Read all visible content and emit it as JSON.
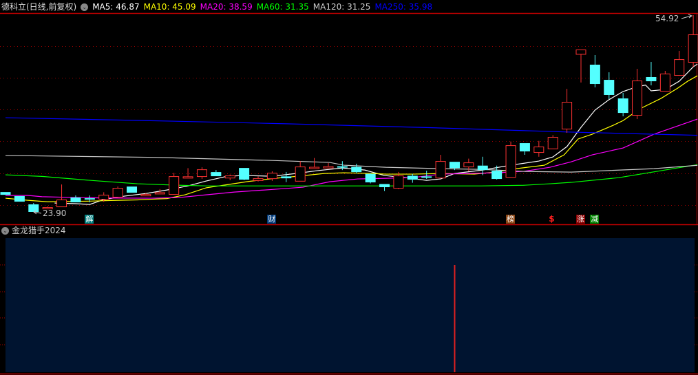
{
  "header": {
    "title": "德科立(日线,前复权)",
    "ma": [
      {
        "label": "MA5: 46.87",
        "color": "#ffffff"
      },
      {
        "label": "MA10: 45.09",
        "color": "#ffff00"
      },
      {
        "label": "MA20: 38.59",
        "color": "#ff00ff"
      },
      {
        "label": "MA60: 31.35",
        "color": "#00ff00"
      },
      {
        "label": "MA120: 31.25",
        "color": "#c8c8c8"
      },
      {
        "label": "MA250: 35.98",
        "color": "#0000ff"
      }
    ]
  },
  "indicator": {
    "title": "金龙猎手2024",
    "signal_candle_index": 32
  },
  "markers": [
    {
      "label": "解",
      "candle": 6,
      "bg": "#008080",
      "color": "#ffffff"
    },
    {
      "label": "财",
      "candle": 19,
      "bg": "#003a7a",
      "color": "#ffffff"
    },
    {
      "label": "榜",
      "candle": 36,
      "bg": "#8b4513",
      "color": "#ffffff"
    },
    {
      "label": "$",
      "candle": 39,
      "bg": "transparent",
      "color": "#ff2020"
    },
    {
      "label": "涨",
      "candle": 41,
      "bg": "#8b0000",
      "color": "#ffffff"
    },
    {
      "label": "减",
      "candle": 42,
      "bg": "#008000",
      "color": "#ffffff"
    }
  ],
  "chart_data": {
    "type": "candlestick",
    "high_label": "54.92",
    "low_label": "23.90",
    "price_max": 54.92,
    "price_min": 23.9,
    "up_color": "#ff3232",
    "down_color": "#54ffff",
    "candles": [
      [
        27.03,
        27.03,
        26.6,
        26.6
      ],
      [
        26.4,
        26.4,
        25.52,
        25.52
      ],
      [
        25.09,
        25.3,
        23.9,
        23.9
      ],
      [
        24.43,
        24.76,
        24.43,
        24.65
      ],
      [
        24.76,
        28.23,
        24.76,
        25.85
      ],
      [
        26.17,
        26.5,
        25.41,
        25.41
      ],
      [
        26.06,
        26.5,
        25.41,
        25.85
      ],
      [
        25.96,
        27.0,
        25.5,
        26.6
      ],
      [
        26.28,
        27.9,
        26.28,
        27.69
      ],
      [
        27.9,
        27.9,
        26.93,
        26.93
      ],
      [
        26.6,
        26.9,
        26.5,
        26.7
      ],
      [
        26.8,
        27.5,
        26.8,
        27.0
      ],
      [
        26.71,
        30.07,
        26.6,
        29.53
      ],
      [
        29.4,
        30.8,
        29.3,
        29.5
      ],
      [
        29.53,
        30.94,
        29.1,
        30.61
      ],
      [
        30.18,
        30.5,
        29.53,
        29.53
      ],
      [
        29.3,
        29.8,
        28.9,
        29.64
      ],
      [
        30.83,
        30.83,
        28.9,
        28.99
      ],
      [
        28.9,
        29.5,
        28.7,
        29.2
      ],
      [
        29.2,
        30.3,
        28.8,
        30.07
      ],
      [
        29.5,
        30.2,
        28.6,
        29.2
      ],
      [
        28.8,
        31.9,
        28.8,
        31.05
      ],
      [
        30.9,
        32.4,
        30.9,
        31.0
      ],
      [
        31.0,
        31.6,
        30.9,
        31.1
      ],
      [
        31.1,
        31.9,
        30.5,
        30.9
      ],
      [
        31.0,
        31.5,
        30.0,
        30.18
      ],
      [
        29.9,
        30.0,
        28.4,
        28.56
      ],
      [
        28.3,
        28.3,
        27.2,
        27.8
      ],
      [
        27.69,
        30.2,
        27.5,
        29.64
      ],
      [
        29.6,
        29.9,
        28.5,
        28.99
      ],
      [
        29.5,
        30.4,
        29.1,
        29.4
      ],
      [
        29.3,
        32.9,
        29.2,
        31.92
      ],
      [
        31.8,
        31.8,
        30.5,
        30.8
      ],
      [
        31.05,
        32.3,
        30.3,
        31.7
      ],
      [
        31.2,
        32.6,
        29.7,
        30.5
      ],
      [
        30.4,
        31.2,
        29.0,
        29.1
      ],
      [
        29.4,
        35.0,
        29.3,
        34.41
      ],
      [
        34.74,
        34.74,
        32.9,
        33.44
      ],
      [
        33.33,
        35.1,
        32.6,
        34.2
      ],
      [
        33.9,
        36.0,
        33.9,
        35.72
      ],
      [
        37.02,
        43.3,
        36.37,
        41.25
      ],
      [
        48.8,
        49.5,
        44.3,
        49.5
      ],
      [
        47.11,
        48.63,
        43.53,
        44.07
      ],
      [
        44.72,
        45.91,
        41.68,
        42.34
      ],
      [
        41.79,
        42.66,
        38.97,
        39.51
      ],
      [
        39.19,
        46.46,
        38.54,
        44.61
      ],
      [
        45.16,
        47.54,
        43.85,
        44.5
      ],
      [
        42.99,
        46.13,
        42.99,
        45.7
      ],
      [
        45.48,
        49.28,
        45.48,
        47.97
      ],
      [
        47.54,
        54.92,
        46.78,
        51.88
      ]
    ],
    "ma_series": [
      {
        "name": "MA5",
        "color": "#ffffff",
        "points": [
          [
            3.5,
            25.3
          ],
          [
            5,
            25.2
          ],
          [
            6,
            25.08
          ],
          [
            7,
            25.84
          ],
          [
            8.5,
            26.4
          ],
          [
            10,
            26.8
          ],
          [
            11.5,
            27.36
          ],
          [
            13,
            28.0
          ],
          [
            14.3,
            28.77
          ],
          [
            15.8,
            29.53
          ],
          [
            17,
            29.64
          ],
          [
            19,
            29.53
          ],
          [
            20.7,
            29.96
          ],
          [
            22.2,
            30.4
          ],
          [
            24,
            30.83
          ],
          [
            25.6,
            30.5
          ],
          [
            27,
            29.64
          ],
          [
            28.5,
            29.3
          ],
          [
            30,
            28.88
          ],
          [
            31,
            29.1
          ],
          [
            32,
            29.96
          ],
          [
            34,
            30.5
          ],
          [
            36,
            31.27
          ],
          [
            38,
            31.92
          ],
          [
            39,
            32.57
          ],
          [
            40,
            34.2
          ],
          [
            41,
            37.23
          ],
          [
            42,
            39.95
          ],
          [
            43,
            41.6
          ],
          [
            44,
            42.88
          ],
          [
            45,
            43.64
          ],
          [
            45.6,
            43.9
          ],
          [
            46,
            42.99
          ],
          [
            47,
            43.2
          ],
          [
            48,
            44.5
          ],
          [
            49,
            46.78
          ],
          [
            49.3,
            47.2
          ]
        ]
      },
      {
        "name": "MA10",
        "color": "#ffff00",
        "points": [
          [
            0,
            26.06
          ],
          [
            1.6,
            25.73
          ],
          [
            3,
            25.5
          ],
          [
            6,
            25.6
          ],
          [
            7.5,
            25.7
          ],
          [
            9.4,
            25.8
          ],
          [
            10.4,
            25.9
          ],
          [
            11.5,
            26.0
          ],
          [
            12.8,
            26.6
          ],
          [
            14.3,
            27.7
          ],
          [
            15.8,
            28.2
          ],
          [
            17.3,
            28.7
          ],
          [
            19.2,
            29.2
          ],
          [
            20.7,
            29.5
          ],
          [
            22.7,
            29.96
          ],
          [
            24.1,
            30.07
          ],
          [
            26.1,
            29.96
          ],
          [
            27.1,
            29.86
          ],
          [
            29,
            29.86
          ],
          [
            31,
            29.96
          ],
          [
            33.4,
            29.86
          ],
          [
            34.9,
            30.18
          ],
          [
            36.4,
            30.72
          ],
          [
            38.4,
            31.27
          ],
          [
            39.8,
            32.9
          ],
          [
            40.8,
            35.4
          ],
          [
            41.8,
            36.15
          ],
          [
            43.3,
            37.56
          ],
          [
            44,
            38.3
          ],
          [
            45.2,
            40.16
          ],
          [
            46.7,
            41.79
          ],
          [
            47.9,
            43.42
          ],
          [
            48.6,
            44.5
          ],
          [
            49.3,
            45.37
          ]
        ]
      },
      {
        "name": "MA20",
        "color": "#ff00ff",
        "points": [
          [
            0,
            26.5
          ],
          [
            1.6,
            26.5
          ],
          [
            2.6,
            26.3
          ],
          [
            4.5,
            26.2
          ],
          [
            7,
            26.1
          ],
          [
            10.4,
            26.06
          ],
          [
            12.4,
            26.17
          ],
          [
            14.3,
            26.6
          ],
          [
            16.3,
            27.03
          ],
          [
            19.2,
            27.47
          ],
          [
            21.2,
            27.8
          ],
          [
            23.1,
            28.66
          ],
          [
            24.1,
            28.88
          ],
          [
            25.1,
            29.1
          ],
          [
            27.1,
            29.2
          ],
          [
            29,
            29.3
          ],
          [
            31,
            29.86
          ],
          [
            33,
            29.96
          ],
          [
            34.9,
            30.07
          ],
          [
            36.9,
            30.29
          ],
          [
            38.8,
            30.94
          ],
          [
            40.3,
            31.8
          ],
          [
            41.8,
            32.9
          ],
          [
            44,
            33.98
          ],
          [
            46.2,
            36.15
          ],
          [
            49.3,
            38.54
          ]
        ]
      },
      {
        "name": "MA60",
        "color": "#00ff00",
        "points": [
          [
            0,
            29.75
          ],
          [
            2.6,
            29.5
          ],
          [
            6,
            28.88
          ],
          [
            9.4,
            28.34
          ],
          [
            12.4,
            28.1
          ],
          [
            14.3,
            28.0
          ],
          [
            17.3,
            28.0
          ],
          [
            24.1,
            28.0
          ],
          [
            33.9,
            28.0
          ],
          [
            36.9,
            28.1
          ],
          [
            38.8,
            28.34
          ],
          [
            40.3,
            28.56
          ],
          [
            43.7,
            29.3
          ],
          [
            46.7,
            30.4
          ],
          [
            49.3,
            31.35
          ]
        ]
      },
      {
        "name": "MA120",
        "color": "#c8c8c8",
        "points": [
          [
            0,
            32.8
          ],
          [
            10.6,
            32.5
          ],
          [
            15.8,
            32.2
          ],
          [
            19.2,
            32.0
          ],
          [
            23.1,
            31.7
          ],
          [
            24.1,
            31.27
          ],
          [
            27.1,
            30.94
          ],
          [
            31,
            30.72
          ],
          [
            33.9,
            30.61
          ],
          [
            36.9,
            30.29
          ],
          [
            40.3,
            30.18
          ],
          [
            46.2,
            30.72
          ],
          [
            49.3,
            31.25
          ]
        ]
      },
      {
        "name": "MA250",
        "color": "#0000ff",
        "points": [
          [
            0,
            38.75
          ],
          [
            10,
            38.3
          ],
          [
            20,
            37.8
          ],
          [
            30,
            37.2
          ],
          [
            40,
            36.5
          ],
          [
            49.3,
            35.98
          ]
        ]
      }
    ]
  }
}
